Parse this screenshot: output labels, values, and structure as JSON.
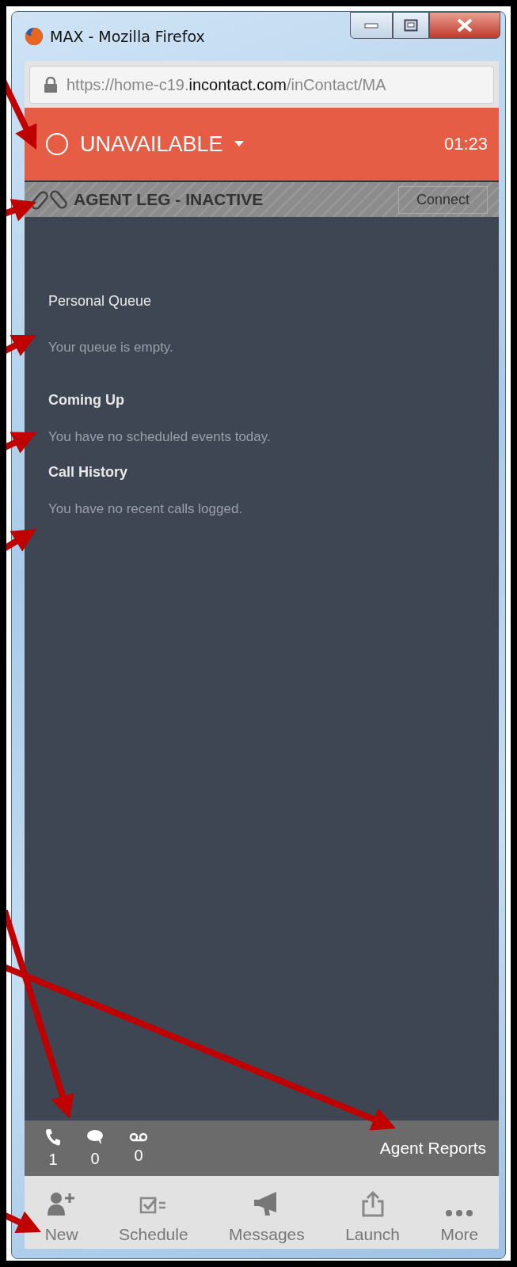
{
  "window": {
    "title": "MAX - Mozilla Firefox"
  },
  "url": {
    "prefix": "https://home-c19.",
    "domain": "incontact.com",
    "path": "/inContact/MA"
  },
  "status": {
    "label": "UNAVAILABLE",
    "timer": "01:23"
  },
  "agent_leg": {
    "label": "AGENT LEG - INACTIVE",
    "button": "Connect"
  },
  "sections": [
    {
      "title": "Personal Queue",
      "message": "Your queue is empty."
    },
    {
      "title": "Coming Up",
      "message": "You have no scheduled events today."
    },
    {
      "title": "Call History",
      "message": "You have no recent calls logged."
    }
  ],
  "counters": [
    {
      "kind": "phone",
      "count": "1"
    },
    {
      "kind": "chat",
      "count": "0"
    },
    {
      "kind": "voicemail",
      "count": "0"
    }
  ],
  "agent_reports": "Agent Reports",
  "nav": [
    {
      "kind": "new",
      "label": "New"
    },
    {
      "kind": "schedule",
      "label": "Schedule"
    },
    {
      "kind": "messages",
      "label": "Messages"
    },
    {
      "kind": "launch",
      "label": "Launch"
    },
    {
      "kind": "more",
      "label": "More"
    }
  ]
}
